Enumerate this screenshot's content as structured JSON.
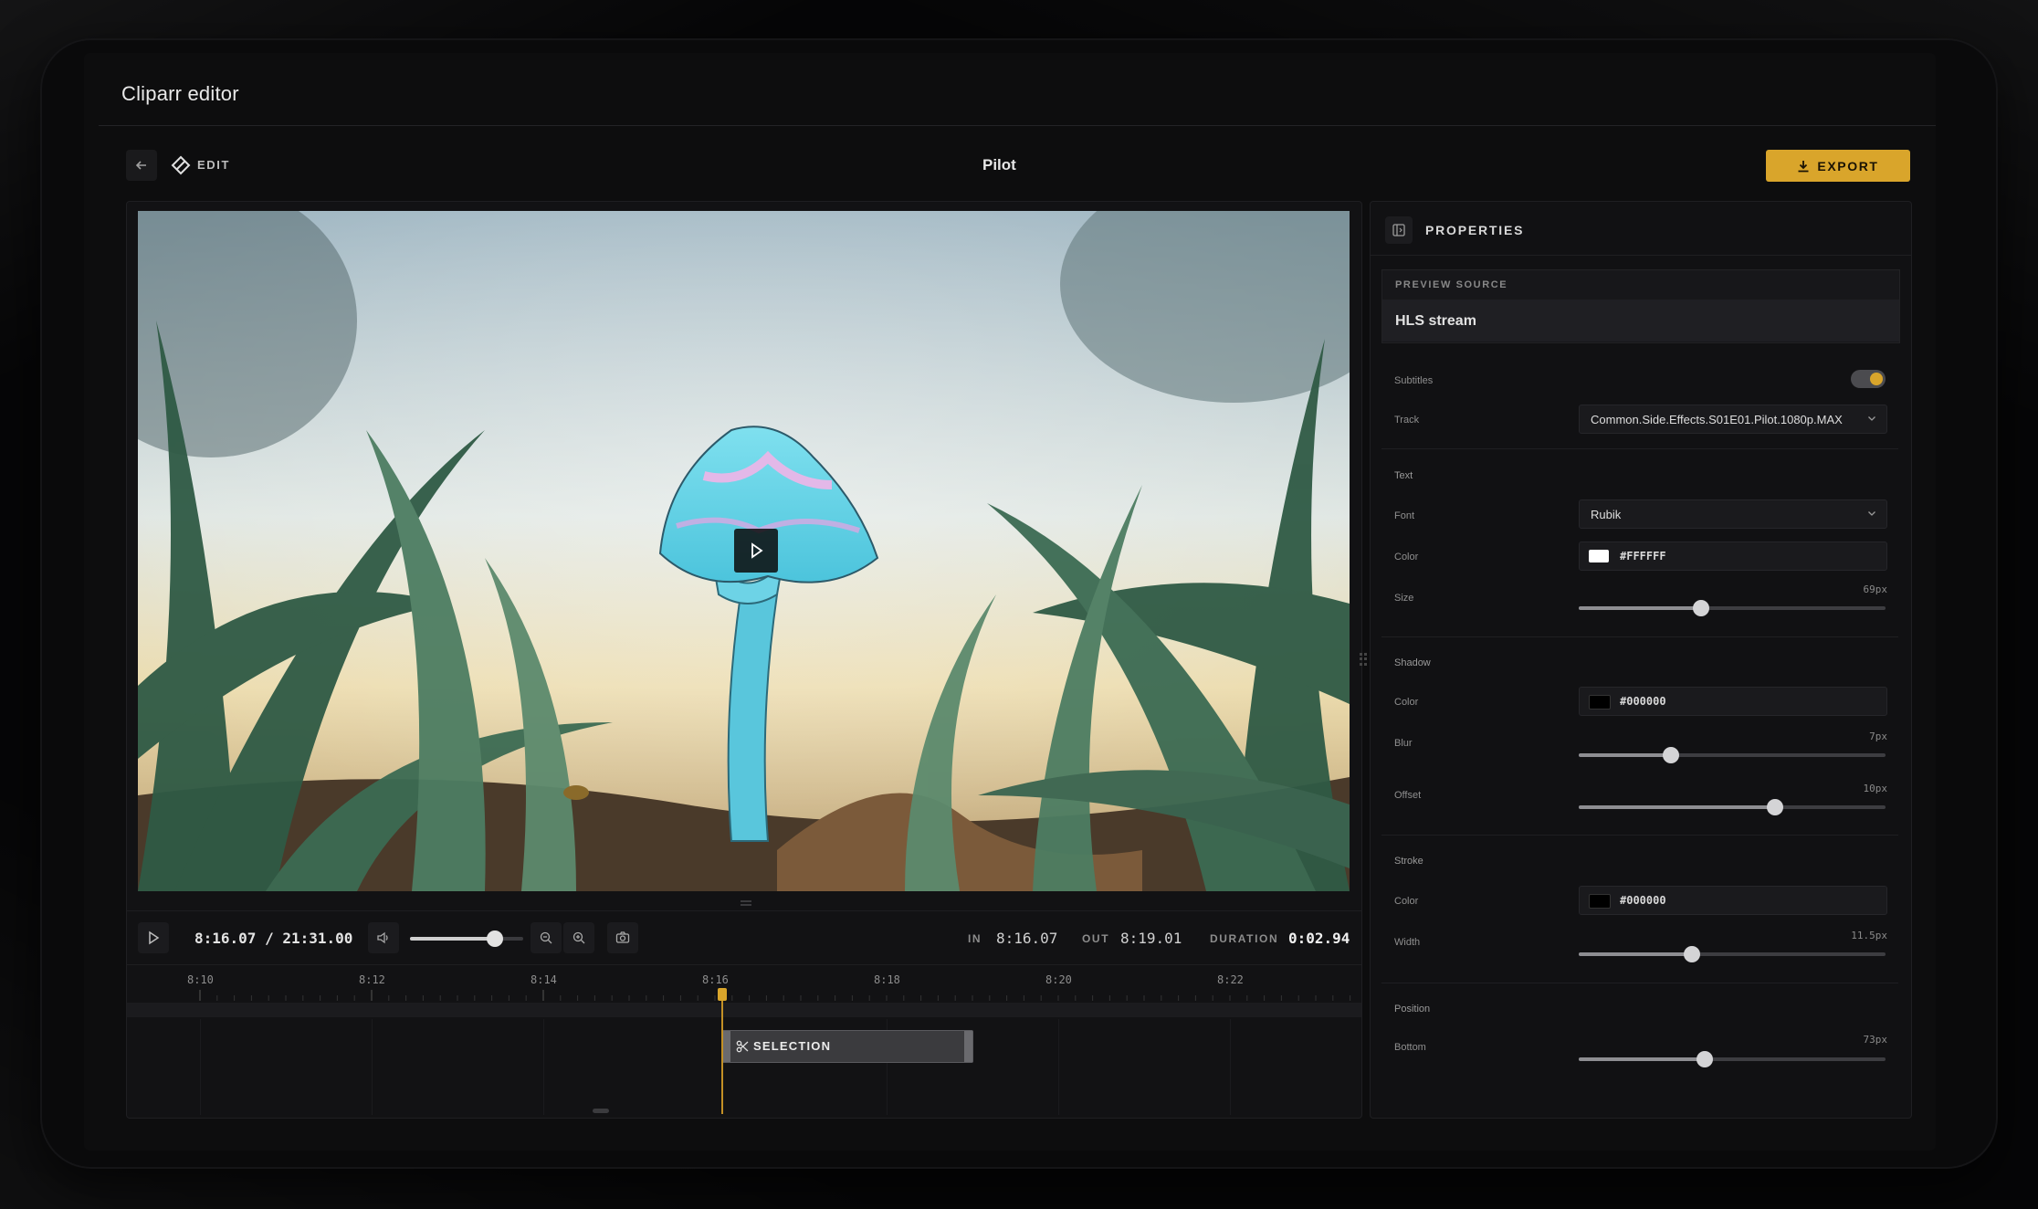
{
  "app": {
    "title": "Cliparr editor"
  },
  "toolbar": {
    "back_label": "←",
    "edit_label": "EDIT",
    "document_title": "Pilot",
    "export_label": "EXPORT"
  },
  "player": {
    "current_time": "8:16.07",
    "separator": "/",
    "total_time": "21:31.00",
    "volume_level": 0.75,
    "in_label": "IN",
    "in_time": "8:16.07",
    "out_label": "OUT",
    "out_time": "8:19.01",
    "duration_label": "DURATION",
    "duration": "0:02.94"
  },
  "timeline": {
    "ticks": [
      "8:10",
      "8:12",
      "8:14",
      "8:16",
      "8:18",
      "8:20",
      "8:22"
    ],
    "selection_label": "SELECTION"
  },
  "properties": {
    "title": "PROPERTIES",
    "preview_source_label": "PREVIEW SOURCE",
    "preview_source_value": "HLS stream",
    "subtitles_label": "Subtitles",
    "subtitles_enabled": true,
    "track_label": "Track",
    "track_value": "Common.Side.Effects.S01E01.Pilot.1080p.MAX",
    "text_section": "Text",
    "font_label": "Font",
    "font_value": "Rubik",
    "color_label": "Color",
    "text_color": "#FFFFFF",
    "size_label": "Size",
    "size_value": "69px",
    "size_level": 0.4,
    "shadow_section": "Shadow",
    "shadow_color_label": "Color",
    "shadow_color": "#000000",
    "blur_label": "Blur",
    "blur_value": "7px",
    "blur_level": 0.3,
    "offset_label": "Offset",
    "offset_value": "10px",
    "offset_level": 0.64,
    "stroke_section": "Stroke",
    "stroke_color_label": "Color",
    "stroke_color": "#000000",
    "width_label": "Width",
    "width_value": "11.5px",
    "width_level": 0.37,
    "position_section": "Position",
    "bottom_label": "Bottom",
    "bottom_value": "73px",
    "bottom_level": 0.41
  },
  "colors": {
    "accent": "#d9a52b",
    "panel": "#111113"
  }
}
